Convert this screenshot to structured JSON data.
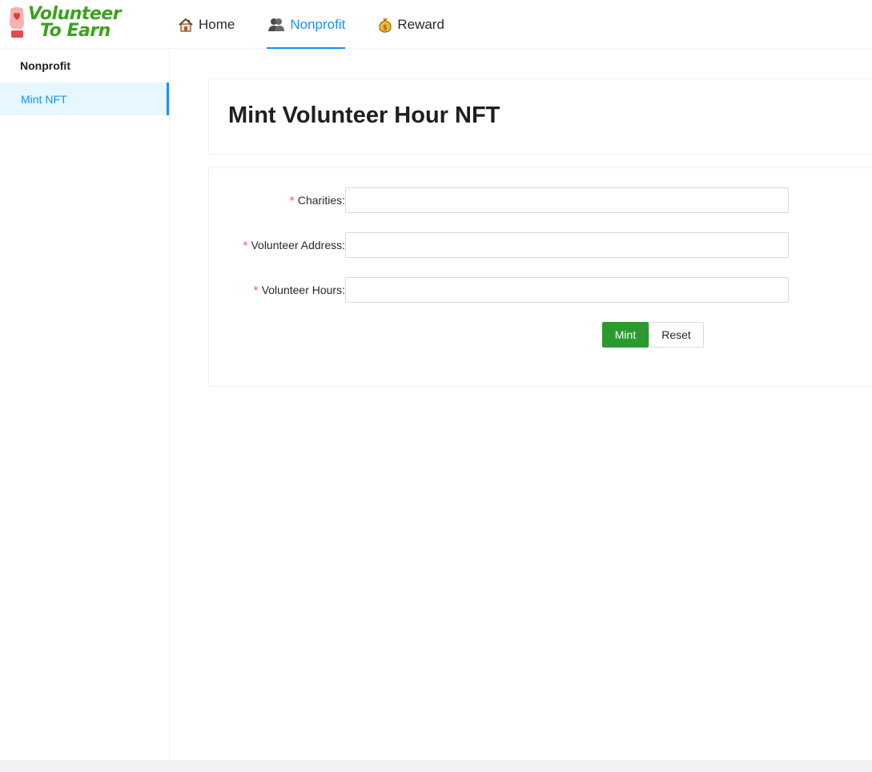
{
  "brand": {
    "line1": "Volunteer",
    "line2": "To Earn"
  },
  "nav": [
    {
      "label": "Home",
      "icon": "house-icon"
    },
    {
      "label": "Nonprofit",
      "icon": "people-icon"
    },
    {
      "label": "Reward",
      "icon": "money-bag-icon"
    }
  ],
  "active_nav": "Nonprofit",
  "sidebar": {
    "title": "Nonprofit",
    "items": [
      {
        "label": "Mint NFT"
      }
    ]
  },
  "page": {
    "title": "Mint Volunteer Hour NFT"
  },
  "form": {
    "required_mark": "*",
    "fields": [
      {
        "label": "Charities",
        "value": ""
      },
      {
        "label": "Volunteer Address",
        "value": ""
      },
      {
        "label": "Volunteer Hours",
        "value": ""
      }
    ],
    "mint_label": "Mint",
    "reset_label": "Reset"
  },
  "colors": {
    "primary": "#1890ff",
    "brand_green": "#3ba21f",
    "mint_button": "#2b9a2e",
    "required": "#ff4d4f"
  }
}
